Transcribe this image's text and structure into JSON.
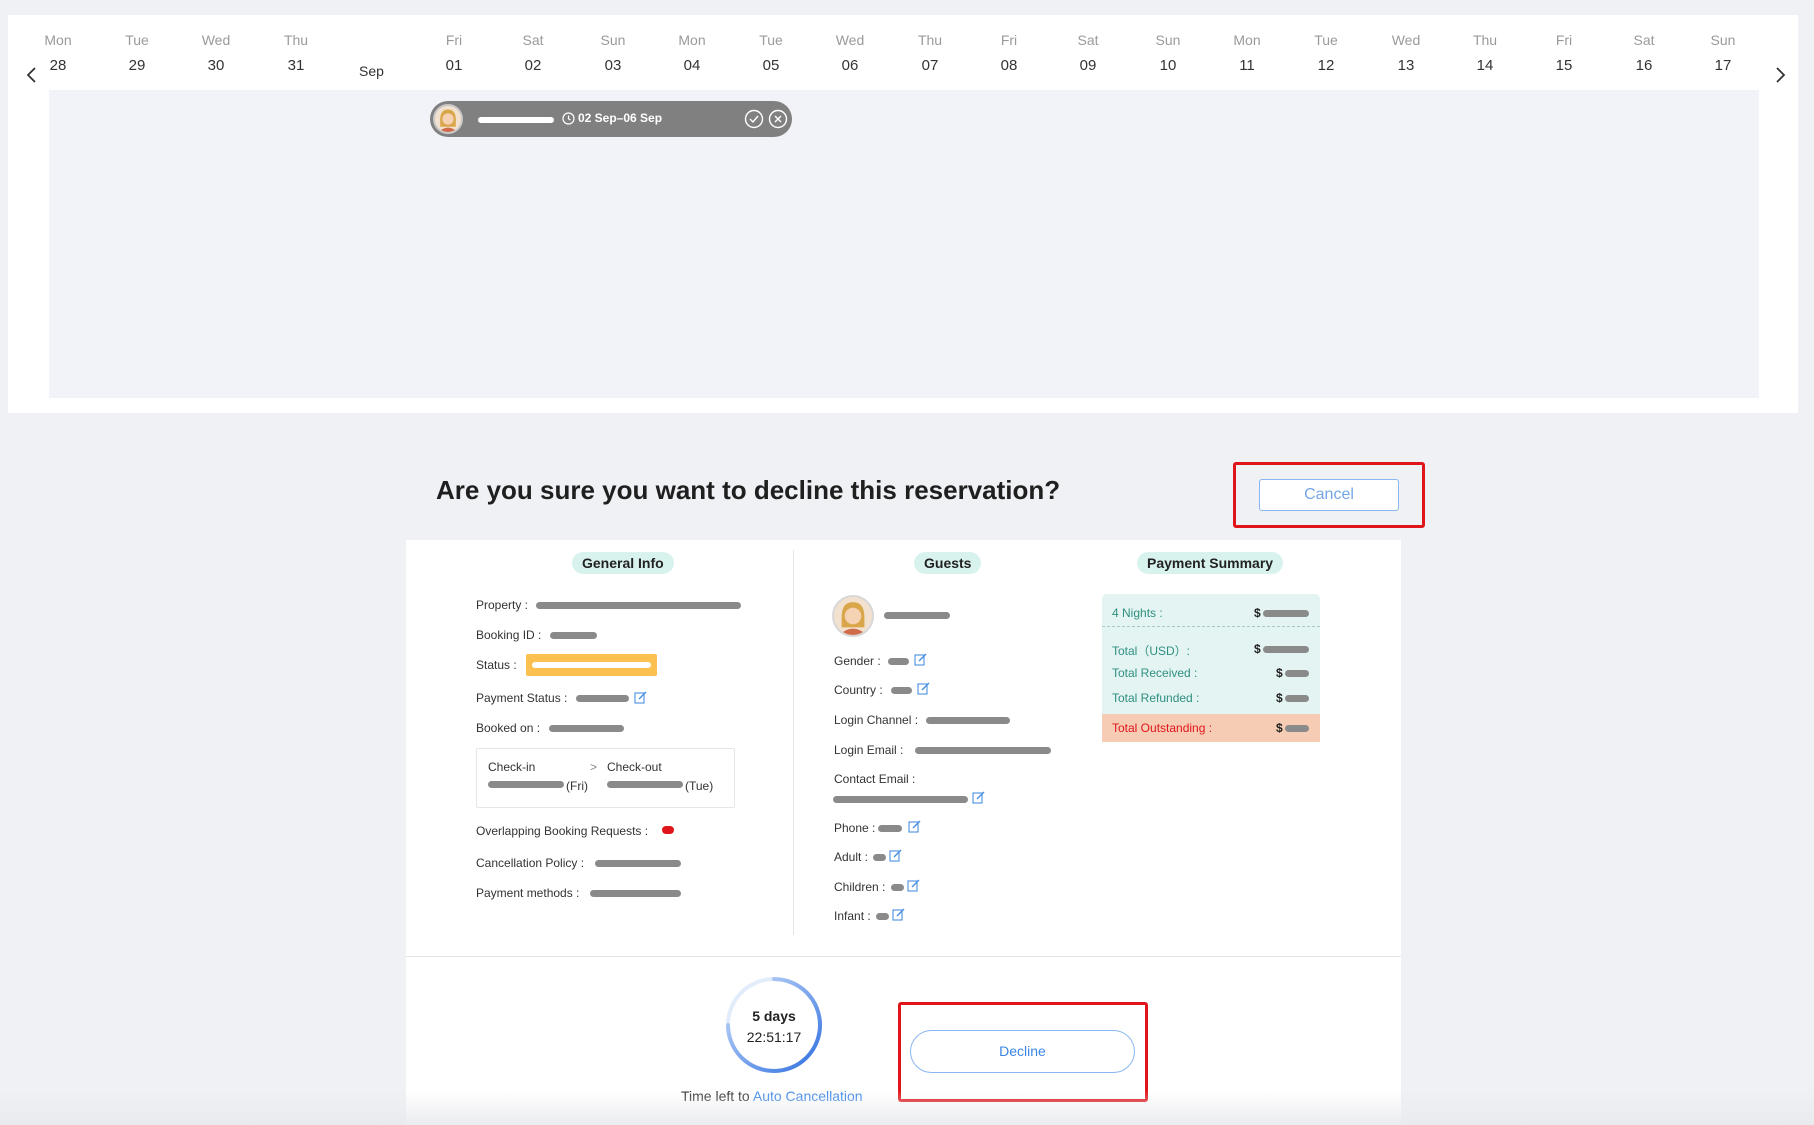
{
  "calendar": {
    "month_label": "Sep",
    "days": [
      {
        "dow": "Mon",
        "num": "28"
      },
      {
        "dow": "Tue",
        "num": "29"
      },
      {
        "dow": "Wed",
        "num": "30"
      },
      {
        "dow": "Thu",
        "num": "31"
      },
      {
        "dow": "Fri",
        "num": "01"
      },
      {
        "dow": "Sat",
        "num": "02"
      },
      {
        "dow": "Sun",
        "num": "03"
      },
      {
        "dow": "Mon",
        "num": "04"
      },
      {
        "dow": "Tue",
        "num": "05"
      },
      {
        "dow": "Wed",
        "num": "06"
      },
      {
        "dow": "Thu",
        "num": "07"
      },
      {
        "dow": "Fri",
        "num": "08"
      },
      {
        "dow": "Sat",
        "num": "09"
      },
      {
        "dow": "Sun",
        "num": "10"
      },
      {
        "dow": "Mon",
        "num": "11"
      },
      {
        "dow": "Tue",
        "num": "12"
      },
      {
        "dow": "Wed",
        "num": "13"
      },
      {
        "dow": "Thu",
        "num": "14"
      },
      {
        "dow": "Fri",
        "num": "15"
      },
      {
        "dow": "Sat",
        "num": "16"
      },
      {
        "dow": "Sun",
        "num": "17"
      }
    ],
    "reservation": {
      "dates": "02 Sep–06 Sep"
    }
  },
  "dialog": {
    "title": "Are you sure you want to decline this reservation?",
    "cancel_label": "Cancel",
    "decline_label": "Decline"
  },
  "general_info": {
    "heading": "General Info",
    "property_label": "Property :",
    "booking_id_label": "Booking ID :",
    "status_label": "Status :",
    "payment_status_label": "Payment Status :",
    "booked_on_label": "Booked on :",
    "checkin_label": "Check-in",
    "checkout_label": "Check-out",
    "arrow": ">",
    "checkin_day": "(Fri)",
    "checkout_day": "(Tue)",
    "overlapping_label": "Overlapping Booking Requests :",
    "cancellation_label": "Cancellation Policy :",
    "payment_methods_label": "Payment methods :"
  },
  "guests": {
    "heading": "Guests",
    "gender_label": "Gender :",
    "country_label": "Country :",
    "login_channel_label": "Login Channel :",
    "login_email_label": "Login Email :",
    "contact_email_label": "Contact Email :",
    "phone_label": "Phone :",
    "adult_label": "Adult :",
    "children_label": "Children :",
    "infant_label": "Infant :"
  },
  "payment_summary": {
    "heading": "Payment Summary",
    "nights_label": "4 Nights :",
    "total_label": "Total（USD）:",
    "received_label": "Total Received :",
    "refunded_label": "Total Refunded :",
    "outstanding_label": "Total Outstanding :",
    "currency": "$",
    "colors": {
      "box": "#e3f4f2",
      "outstanding_bg": "#f6cdb4",
      "outstanding_text": "#e0141b",
      "label_text": "#2f8f80"
    }
  },
  "timer": {
    "days": "5 days",
    "clock": "22:51:17",
    "caption": "Time left to",
    "link": "Auto Cancellation"
  },
  "colors": {
    "accent": "#3b86e6",
    "highlight": "#e0141b",
    "status": "#fbc04f"
  }
}
